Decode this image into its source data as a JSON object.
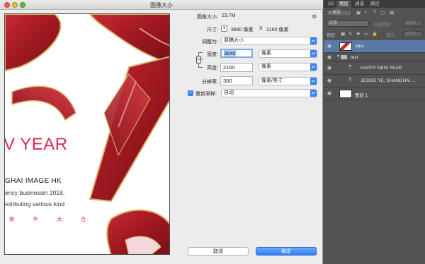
{
  "dialog": {
    "title": "图像大小",
    "image_size_label": "图像大小:",
    "image_size_value": "23.7M",
    "dimensions_label": "尺寸:",
    "dimensions_width": "3840 像素",
    "dimensions_x": "X",
    "dimensions_height": "2160 像素",
    "fit_to_label": "调整为:",
    "fit_to_value": "原稿大小",
    "width_label": "宽度:",
    "width_value": "3840",
    "width_unit": "像素",
    "height_label": "高度:",
    "height_value": "2160",
    "height_unit": "像素",
    "resolution_label": "分辨率:",
    "resolution_value": "300",
    "resolution_unit": "像素/英寸",
    "resample_label": "重新采样:",
    "resample_value": "自动",
    "cancel_label": "取消",
    "ok_label": "确定"
  },
  "preview": {
    "year_text": "V YEAR",
    "company_text": "GHAI IMAGE HK",
    "line1": "ency businessin 2018,",
    "line2": "istributing various kind",
    "chinese_text": "新 年 大 吉"
  },
  "panel": {
    "tabs": [
      "3D",
      "图层",
      "通道",
      "路径"
    ],
    "active_tab": 1,
    "filter_select": "类型",
    "blend_mode": "正常",
    "opacity_label": "不透明度:",
    "opacity_value": "100%",
    "lock_label": "锁定:",
    "fill_label": "填充:",
    "fill_value": "100%",
    "layers": [
      {
        "name": "rgba",
        "type": "image",
        "selected": true
      },
      {
        "name": "text",
        "type": "group",
        "selected": false
      },
      {
        "name": "HAPPY NEW YEAR",
        "type": "text",
        "selected": false
      },
      {
        "name": "JESSIE YE, SHANGHAI ...",
        "type": "text",
        "selected": false
      },
      {
        "name": "图层 1",
        "type": "image",
        "selected": false
      }
    ]
  },
  "colors": {
    "accent_blue": "#3b82f0",
    "preview_red": "#e0284f",
    "selected_layer": "#587aa6"
  }
}
